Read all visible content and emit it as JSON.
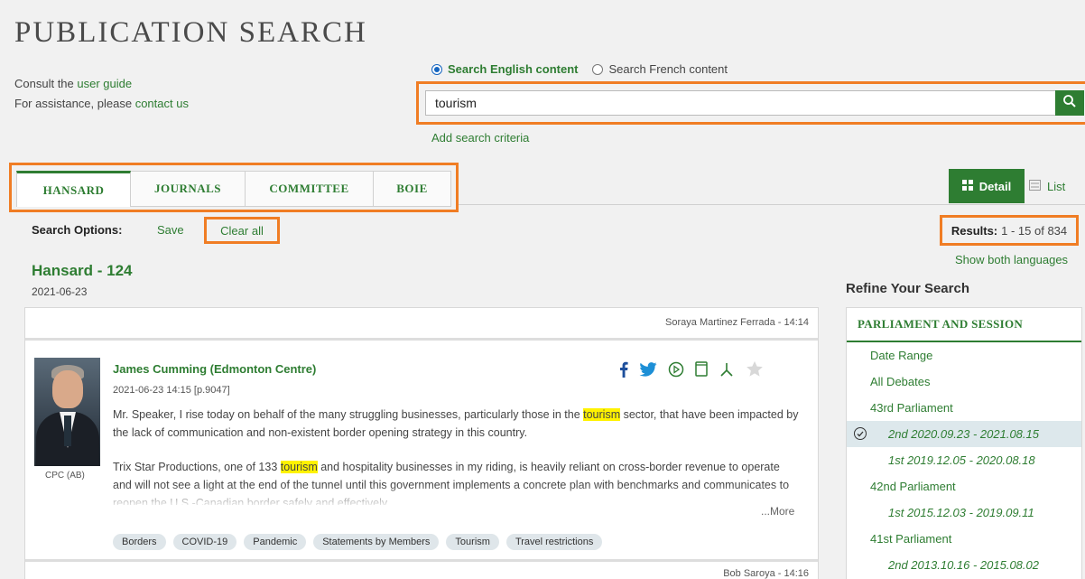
{
  "header": {
    "title": "PUBLICATION SEARCH",
    "consult_prefix": "Consult the ",
    "user_guide": "user guide",
    "assist_prefix": "For assistance, please ",
    "contact_us": "contact us"
  },
  "search": {
    "radio_english": "Search English content",
    "radio_french": "Search French content",
    "value": "tourism",
    "add_criteria": "Add search criteria"
  },
  "tabs": [
    {
      "label": "HANSARD",
      "active": true
    },
    {
      "label": "JOURNALS",
      "active": false
    },
    {
      "label": "COMMITTEE",
      "active": false
    },
    {
      "label": "BOIE",
      "active": false
    }
  ],
  "view": {
    "detail": "Detail",
    "list": "List"
  },
  "options": {
    "label": "Search Options:",
    "save": "Save",
    "clear_all": "Clear all",
    "results_label": "Results:",
    "results_value": "1 - 15 of 834",
    "show_both": "Show both languages"
  },
  "hansard": {
    "title": "Hansard - 124",
    "date": "2021-06-23"
  },
  "result": {
    "top_speaker": "Soraya Martinez Ferrada - 14:14",
    "speaker_name": "James Cumming (Edmonton Centre)",
    "speaker_time": "2021-06-23 14:15 [p.9047]",
    "party": "CPC (AB)",
    "p1_a": "Mr. Speaker, I rise today on behalf of the many struggling businesses, particularly those in the ",
    "p1_hl": "tourism",
    "p1_b": " sector, that have been impacted by the lack of communication and non-existent border opening strategy in this country.",
    "p2_a": "Trix Star Productions, one of 133 ",
    "p2_hl": "tourism",
    "p2_b": " and hospitality businesses in my riding, is heavily reliant on cross-border revenue to operate and will not see a light at the end of the tunnel until this government implements a concrete plan with benchmarks and communicates to reopen the U.S.-Canadian border safely and effectively.",
    "more": "...More",
    "tags": [
      "Borders",
      "COVID-19",
      "Pandemic",
      "Statements by Members",
      "Tourism",
      "Travel restrictions"
    ],
    "next_speaker": "Bob Saroya - 14:16"
  },
  "refine": {
    "title": "Refine Your Search",
    "heading": "PARLIAMENT AND SESSION",
    "items": [
      {
        "label": "Date Range",
        "level": 1
      },
      {
        "label": "All Debates",
        "level": 1
      },
      {
        "label": "43rd Parliament",
        "level": 1
      },
      {
        "label": "2nd 2020.09.23 - 2021.08.15",
        "level": 2,
        "selected": true
      },
      {
        "label": "1st 2019.12.05 - 2020.08.18",
        "level": 2
      },
      {
        "label": "42nd Parliament",
        "level": 1
      },
      {
        "label": "1st 2015.12.03 - 2019.09.11",
        "level": 2
      },
      {
        "label": "41st Parliament",
        "level": 1
      },
      {
        "label": "2nd 2013.10.16 - 2015.08.02",
        "level": 2
      }
    ]
  },
  "colors": {
    "accent": "#2e7d32",
    "highlight_box": "#f07d24",
    "keyword_highlight": "#fff200"
  },
  "icons": [
    "facebook-icon",
    "twitter-icon",
    "play-icon",
    "bookmark-icon",
    "pdf-icon",
    "star-icon",
    "search-icon",
    "grid-icon",
    "list-icon",
    "check-circle-icon"
  ]
}
